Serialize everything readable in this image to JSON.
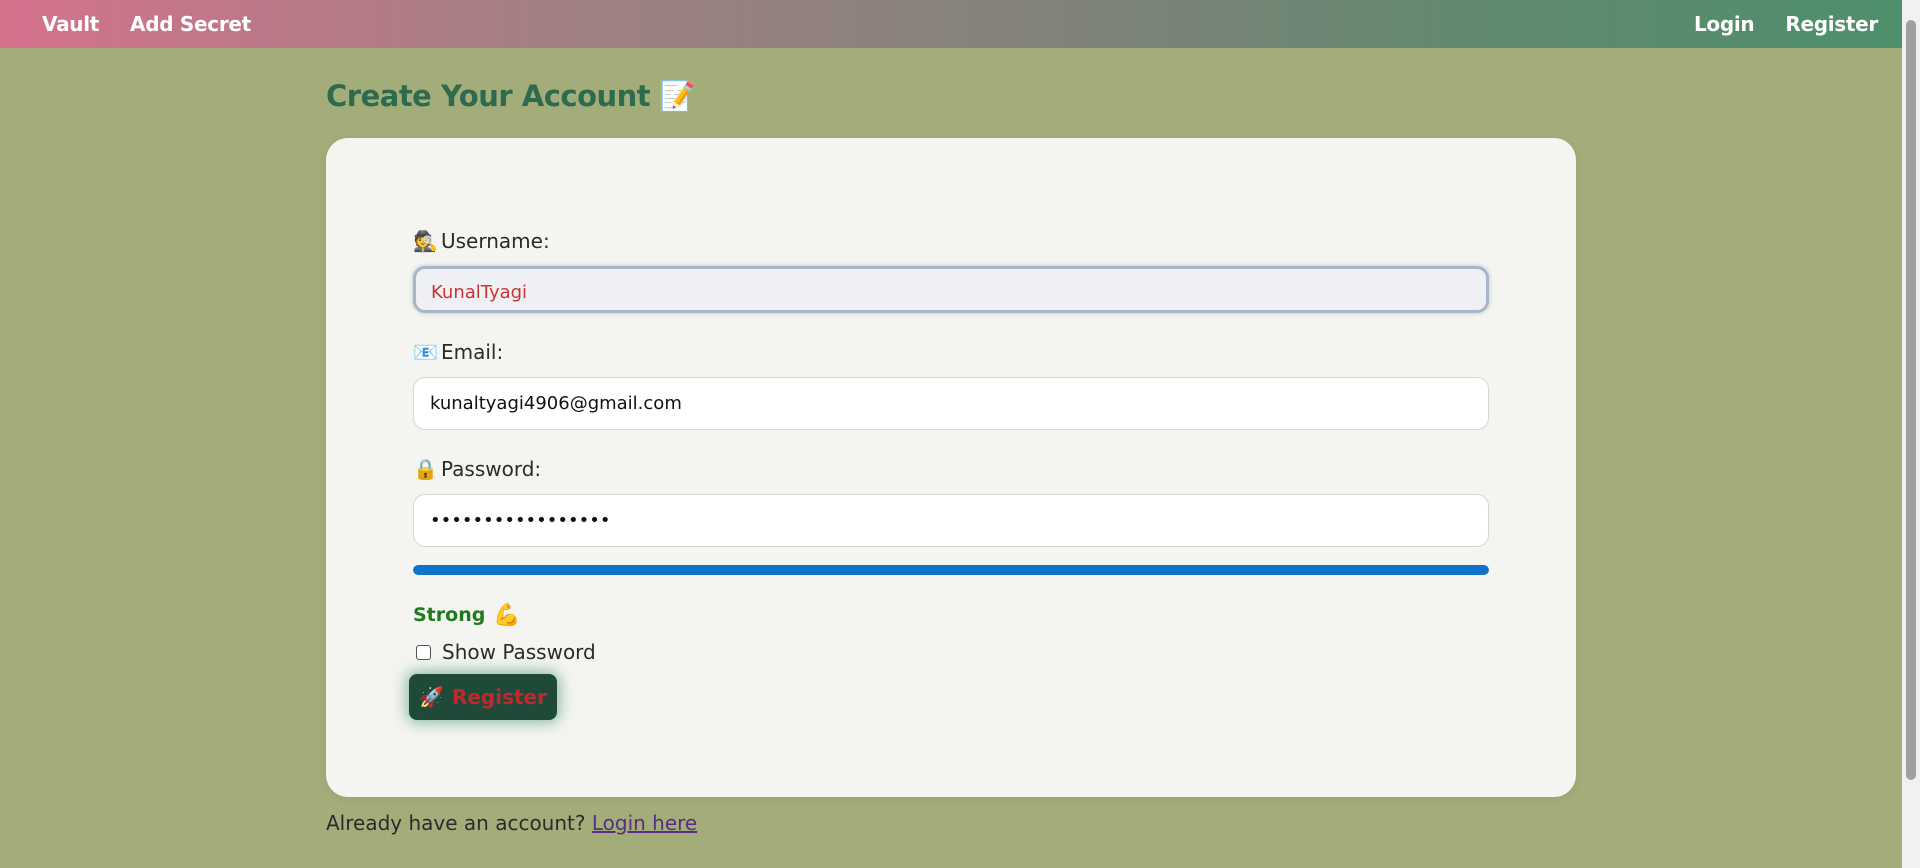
{
  "nav": {
    "left": [
      "Vault",
      "Add Secret"
    ],
    "right": [
      "Login",
      "Register"
    ]
  },
  "page": {
    "title": "Create Your Account",
    "title_icon": "📝"
  },
  "form": {
    "username": {
      "icon": "🕵️",
      "label": "Username:",
      "value": "KunalTyagi"
    },
    "email": {
      "icon": "📧",
      "label": "Email:",
      "value": "kunaltyagi4906@gmail.com"
    },
    "password": {
      "icon": "🔒",
      "label": "Password:",
      "value": "•••••••••••••••••"
    },
    "strength": {
      "label": "Strong",
      "icon": "💪",
      "fraction": 1.0,
      "color": "#0f73c9"
    },
    "show_password_label": "Show Password",
    "submit": {
      "icon": "🚀",
      "label": "Register"
    }
  },
  "footer": {
    "text": "Already have an account?",
    "link": "Login here"
  }
}
